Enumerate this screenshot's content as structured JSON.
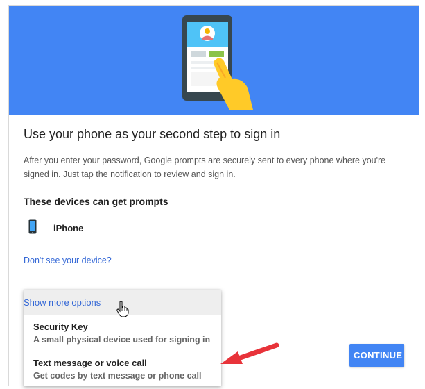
{
  "page": {
    "title": "Use your phone as your second step to sign in",
    "description": "After you enter your password, Google prompts are securely sent to every phone where you're signed in. Just tap the notification to review and sign in.",
    "devices_heading": "These devices can get prompts"
  },
  "devices": [
    {
      "name": "iPhone",
      "icon": "smartphone-icon"
    }
  ],
  "links": {
    "missing_device": "Don't see your device?"
  },
  "options_menu": {
    "header": "Show more options",
    "items": [
      {
        "title": "Security Key",
        "subtitle": "A small physical device used for signing in"
      },
      {
        "title": "Text message or voice call",
        "subtitle": "Get codes by text message or phone call"
      }
    ]
  },
  "buttons": {
    "continue": "CONTINUE"
  },
  "colors": {
    "hero_background": "#4285f4",
    "link": "#3367d6",
    "primary_button": "#4285f4",
    "annotation_arrow": "#e8333a"
  }
}
